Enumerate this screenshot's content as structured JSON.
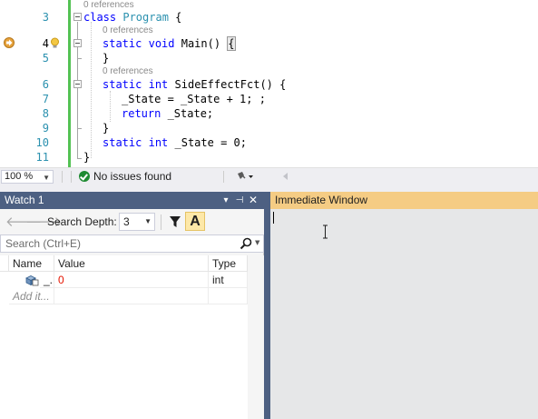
{
  "editor": {
    "line_numbers": [
      "3",
      "4",
      "5",
      "6",
      "7",
      "8",
      "9",
      "10",
      "11"
    ],
    "reference_hints": [
      "0 references",
      "0 references",
      "0 references"
    ],
    "code": {
      "l3": {
        "kw": "class",
        "name": "Program",
        "rest": " {"
      },
      "l4": {
        "kw1": "static",
        "kw2": "void",
        "rest": " Main() ",
        "brace": "{"
      },
      "l5": {
        "text": "}"
      },
      "l6": {
        "kw1": "static",
        "kw2": "int",
        "name": "SideEffectFct",
        "rest": "() {"
      },
      "l7": {
        "text": "_State = _State + 1; ;"
      },
      "l8": {
        "kw": "return",
        "rest": " _State;"
      },
      "l9": {
        "text": "}"
      },
      "l10": {
        "kw1": "static",
        "kw2": "int",
        "rest": " _State = 0;"
      },
      "l11": {
        "text": "}"
      }
    }
  },
  "status_bar": {
    "zoom": "100 %",
    "issues": "No issues found"
  },
  "watch": {
    "title": "Watch 1",
    "search_depth_label": "Search Depth:",
    "search_depth_value": "3",
    "search_placeholder": "Search (Ctrl+E)",
    "aa_button": "A",
    "columns": [
      "Name",
      "Value",
      "Type"
    ],
    "rows": [
      {
        "name": "_...",
        "value": "0",
        "type": "int"
      }
    ],
    "add_item": "Add it..."
  },
  "immediate": {
    "title": "Immediate Window"
  },
  "colors": {
    "tool_window_title": "#4d6082",
    "active_title": "#f5cc84",
    "keyword": "#0000ff",
    "type": "#2b91af",
    "changed_value": "#e51400",
    "change_bar": "#54c254"
  },
  "icons": [
    "breakpoint-arrow-icon",
    "lightbulb-icon",
    "check-circle-icon",
    "broom-icon",
    "filter-icon",
    "search-icon",
    "property-icon",
    "ibeam-cursor-icon"
  ]
}
